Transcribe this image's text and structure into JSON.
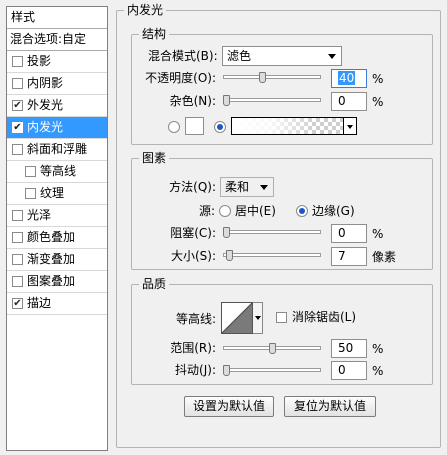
{
  "styles_panel": {
    "header": "样式",
    "blending_options": "混合选项:自定",
    "items": [
      {
        "label": "投影",
        "checked": false,
        "selected": false,
        "sub": false
      },
      {
        "label": "内阴影",
        "checked": false,
        "selected": false,
        "sub": false
      },
      {
        "label": "外发光",
        "checked": true,
        "selected": false,
        "sub": false
      },
      {
        "label": "内发光",
        "checked": true,
        "selected": true,
        "sub": false
      },
      {
        "label": "斜面和浮雕",
        "checked": false,
        "selected": false,
        "sub": false
      },
      {
        "label": "等高线",
        "checked": false,
        "selected": false,
        "sub": true
      },
      {
        "label": "纹理",
        "checked": false,
        "selected": false,
        "sub": true
      },
      {
        "label": "光泽",
        "checked": false,
        "selected": false,
        "sub": false
      },
      {
        "label": "颜色叠加",
        "checked": false,
        "selected": false,
        "sub": false
      },
      {
        "label": "渐变叠加",
        "checked": false,
        "selected": false,
        "sub": false
      },
      {
        "label": "图案叠加",
        "checked": false,
        "selected": false,
        "sub": false
      },
      {
        "label": "描边",
        "checked": true,
        "selected": false,
        "sub": false
      }
    ]
  },
  "inner_glow": {
    "title": "内发光",
    "structure": {
      "title": "结构",
      "blend_mode_label": "混合模式(B):",
      "blend_mode_value": "滤色",
      "opacity_label": "不透明度(O):",
      "opacity_value": "40",
      "opacity_percent": 40,
      "opacity_unit": "%",
      "noise_label": "杂色(N):",
      "noise_value": "0",
      "noise_percent": 0,
      "noise_unit": "%"
    },
    "elements": {
      "title": "图素",
      "technique_label": "方法(Q):",
      "technique_value": "柔和",
      "source_label": "源:",
      "source_center": "居中(E)",
      "source_edge": "边缘(G)",
      "source_selected": "edge",
      "choke_label": "阻塞(C):",
      "choke_value": "0",
      "choke_percent": 0,
      "choke_unit": "%",
      "size_label": "大小(S):",
      "size_value": "7",
      "size_fraction": 0.03,
      "size_unit": "像素"
    },
    "quality": {
      "title": "品质",
      "contour_label": "等高线:",
      "anti_alias_label": "消除锯齿(L)",
      "anti_alias_checked": false,
      "range_label": "范围(R):",
      "range_value": "50",
      "range_percent": 50,
      "range_unit": "%",
      "jitter_label": "抖动(J):",
      "jitter_value": "0",
      "jitter_percent": 0,
      "jitter_unit": "%"
    },
    "buttons": {
      "make_default": "设置为默认值",
      "reset_default": "复位为默认值"
    }
  }
}
